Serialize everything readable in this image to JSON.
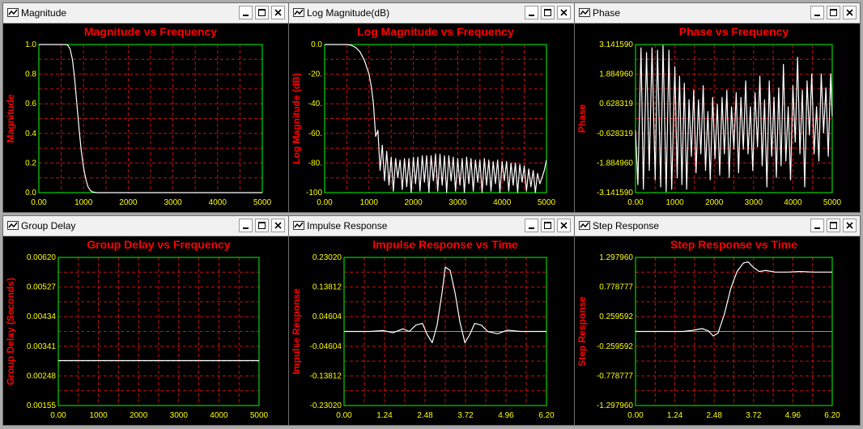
{
  "theme": {
    "titleColor": "#ff0000",
    "tickColor": "#ffff00",
    "gridColor": "#c81010",
    "frameColor": "#00ff00",
    "traceColor": "#ffffff",
    "zeroColor": "#00ff00"
  },
  "windows": [
    {
      "title": "Magnitude",
      "chart_data": {
        "type": "line",
        "title": "Magnitude vs Frequency",
        "xlabel": "",
        "ylabel": "Magnitude",
        "xlim": [
          0,
          5000
        ],
        "ylim": [
          0,
          1.0
        ],
        "xticks": [
          "0.00",
          "1000",
          "2000",
          "3000",
          "4000",
          "5000"
        ],
        "yticks": [
          "1.0",
          "0.8",
          "0.6",
          "0.4",
          "0.2",
          "0.0"
        ],
        "x": [
          0,
          500,
          600,
          650,
          700,
          750,
          800,
          850,
          900,
          950,
          1000,
          1050,
          1100,
          1150,
          1200,
          1300,
          1500,
          2000,
          3000,
          4000,
          5000
        ],
        "y": [
          1,
          1,
          1,
          0.995,
          0.97,
          0.9,
          0.77,
          0.6,
          0.43,
          0.28,
          0.17,
          0.09,
          0.04,
          0.015,
          0.005,
          0,
          0,
          0,
          0,
          0,
          0
        ],
        "gridX": 10,
        "gridY": 10
      }
    },
    {
      "title": "Log Magnitude(dB)",
      "chart_data": {
        "type": "line",
        "title": "Log Magnitude vs Frequency",
        "xlabel": "",
        "ylabel": "Log Magnitude (dB)",
        "xlim": [
          0,
          5000
        ],
        "ylim": [
          -100,
          0
        ],
        "xticks": [
          "0.00",
          "1000",
          "2000",
          "3000",
          "4000",
          "5000"
        ],
        "yticks": [
          "0.0",
          "-20.",
          "-40.",
          "-60.",
          "-80.",
          "-100"
        ],
        "x": [
          0,
          500,
          600,
          700,
          800,
          900,
          1000,
          1050,
          1100,
          1150,
          1200,
          1250,
          1300,
          1350,
          1400,
          1450,
          1500,
          1550,
          1600,
          1650,
          1700,
          1750,
          1800,
          1850,
          1900,
          1950,
          2000,
          2050,
          2100,
          2150,
          2200,
          2250,
          2300,
          2350,
          2400,
          2450,
          2500,
          2550,
          2600,
          2650,
          2700,
          2750,
          2800,
          2850,
          2900,
          2950,
          3000,
          3050,
          3100,
          3150,
          3200,
          3250,
          3300,
          3350,
          3400,
          3450,
          3500,
          3550,
          3600,
          3650,
          3700,
          3750,
          3800,
          3850,
          3900,
          3950,
          4000,
          4050,
          4100,
          4150,
          4200,
          4250,
          4300,
          4350,
          4400,
          4450,
          4500,
          4550,
          4600,
          4650,
          4700,
          4750,
          4800,
          4850,
          4900,
          4950,
          5000
        ],
        "y": [
          0,
          0,
          -0.5,
          -2,
          -5,
          -11,
          -20,
          -28,
          -40,
          -62,
          -58,
          -85,
          -68,
          -92,
          -72,
          -95,
          -76,
          -99,
          -77,
          -90,
          -78,
          -98,
          -77,
          -96,
          -77,
          -100,
          -76,
          -94,
          -76,
          -99,
          -75,
          -93,
          -75,
          -100,
          -75,
          -92,
          -74,
          -99,
          -74,
          -95,
          -75,
          -100,
          -75,
          -92,
          -76,
          -99,
          -77,
          -95,
          -77,
          -100,
          -76,
          -94,
          -77,
          -99,
          -78,
          -93,
          -78,
          -100,
          -77,
          -95,
          -78,
          -99,
          -79,
          -94,
          -78,
          -100,
          -79,
          -92,
          -79,
          -99,
          -80,
          -95,
          -80,
          -100,
          -81,
          -93,
          -82,
          -99,
          -84,
          -96,
          -85,
          -100,
          -87,
          -94,
          -90,
          -85,
          -78
        ],
        "gridX": 10,
        "gridY": 10
      }
    },
    {
      "title": "Phase",
      "chart_data": {
        "type": "line",
        "title": "Phase vs Frequency",
        "xlabel": "",
        "ylabel": "Phase",
        "xlim": [
          0,
          5000
        ],
        "ylim": [
          -3.14159,
          3.14159
        ],
        "xticks": [
          "0.00",
          "1000",
          "2000",
          "3000",
          "4000",
          "5000"
        ],
        "yticks": [
          "3.141590",
          "1.884960",
          "0.628319",
          "-0.628319",
          "-1.884960",
          "-3.141590"
        ],
        "x": [
          0,
          60,
          140,
          200,
          280,
          350,
          420,
          500,
          560,
          640,
          700,
          780,
          850,
          920,
          1000,
          1060,
          1120,
          1180,
          1240,
          1300,
          1360,
          1420,
          1480,
          1540,
          1600,
          1660,
          1720,
          1780,
          1840,
          1900,
          1960,
          2020,
          2080,
          2140,
          2200,
          2260,
          2320,
          2380,
          2440,
          2500,
          2560,
          2620,
          2680,
          2740,
          2800,
          2860,
          2920,
          2980,
          3040,
          3100,
          3160,
          3220,
          3280,
          3340,
          3400,
          3460,
          3520,
          3580,
          3640,
          3700,
          3760,
          3820,
          3880,
          3940,
          4000,
          4060,
          4120,
          4180,
          4240,
          4300,
          4360,
          4420,
          4480,
          4540,
          4600,
          4660,
          4720,
          4780,
          4840,
          4900,
          4960,
          5000
        ],
        "y": [
          -0.5,
          -2.8,
          3.0,
          -3.0,
          2.8,
          -2.2,
          3.0,
          -2.6,
          2.9,
          -2.9,
          3.1,
          -3.1,
          2.9,
          -3.0,
          2.2,
          -2.5,
          1.8,
          -2.8,
          1.5,
          -3.0,
          0.8,
          -1.6,
          1.2,
          -2.3,
          0.8,
          -1.5,
          1.4,
          -2.2,
          0.3,
          -2.6,
          0.9,
          -1.7,
          0.6,
          -2.4,
          0.9,
          -1.5,
          1.2,
          -2.5,
          0.5,
          -1.3,
          1.1,
          -2.3,
          0.9,
          -1.3,
          1.6,
          -1.5,
          0.5,
          -2.2,
          1.1,
          -1.2,
          1.8,
          -2.0,
          0.8,
          -2.9,
          1.6,
          -1.6,
          0.9,
          -2.5,
          1.3,
          -2.0,
          2.3,
          -1.8,
          0.5,
          -2.6,
          1.4,
          -1.0,
          2.6,
          -1.5,
          1.2,
          -2.9,
          1.6,
          -0.7,
          1.9,
          -1.5,
          0.5,
          -1.8,
          1.9,
          -0.6,
          1.3,
          -1.6,
          1.9,
          0.1
        ],
        "gridX": 10,
        "gridY": 10
      }
    },
    {
      "title": "Group Delay",
      "chart_data": {
        "type": "line",
        "title": "Group Delay vs Frequency",
        "xlabel": "",
        "ylabel": "Group Delay (Seconds)",
        "xlim": [
          0,
          5000
        ],
        "ylim": [
          0.00155,
          0.0062
        ],
        "xticks": [
          "0.00",
          "1000",
          "2000",
          "3000",
          "4000",
          "5000"
        ],
        "yticks": [
          "0.00620",
          "0.00527",
          "0.00434",
          "0.00341",
          "0.00248",
          "0.00155"
        ],
        "x": [
          0,
          5000
        ],
        "y": [
          0.00296,
          0.00296
        ],
        "gridX": 10,
        "gridY": 10
      }
    },
    {
      "title": "Impulse Response",
      "chart_data": {
        "type": "line",
        "title": "Impulse Response vs Time",
        "xlabel": "",
        "ylabel": "Impulse Response",
        "xlim": [
          0,
          6.2
        ],
        "ylim": [
          -0.2302,
          0.2302
        ],
        "zeroLine": true,
        "xticks": [
          "0.00",
          "1.24",
          "2.48",
          "3.72",
          "4.96",
          "6.20"
        ],
        "yticks": [
          "0.23020",
          "0.13812",
          "0.04604",
          "-0.04604",
          "-0.13812",
          "-0.23020"
        ],
        "x": [
          0,
          0.8,
          1.2,
          1.5,
          1.8,
          2.0,
          2.2,
          2.4,
          2.55,
          2.7,
          2.85,
          3.0,
          3.1,
          3.25,
          3.4,
          3.55,
          3.7,
          3.85,
          4.0,
          4.2,
          4.4,
          4.7,
          5.0,
          5.4,
          6.2
        ],
        "y": [
          0,
          0,
          0.003,
          -0.004,
          0.008,
          0,
          0.02,
          0.025,
          -0.01,
          -0.035,
          0.02,
          0.12,
          0.2,
          0.19,
          0.12,
          0.03,
          -0.035,
          -0.01,
          0.025,
          0.02,
          0,
          -0.007,
          0.004,
          0,
          0
        ],
        "gridX": 10,
        "gridY": 10
      }
    },
    {
      "title": "Step Response",
      "chart_data": {
        "type": "line",
        "title": "Step Response vs Time",
        "xlabel": "",
        "ylabel": "Step Response",
        "xlim": [
          0,
          6.2
        ],
        "ylim": [
          -1.29796,
          1.29796
        ],
        "zeroLine": true,
        "xticks": [
          "0.00",
          "1.24",
          "2.48",
          "3.72",
          "4.96",
          "6.20"
        ],
        "yticks": [
          "1.297960",
          "0.778777",
          "0.259592",
          "-0.259592",
          "-0.778777",
          "-1.297960"
        ],
        "x": [
          0,
          1.5,
          1.8,
          2.1,
          2.3,
          2.45,
          2.6,
          2.8,
          3.0,
          3.2,
          3.4,
          3.55,
          3.7,
          3.9,
          4.1,
          4.4,
          4.8,
          5.2,
          5.6,
          6.2
        ],
        "y": [
          0,
          0,
          0.02,
          0.05,
          0.01,
          -0.08,
          -0.03,
          0.3,
          0.75,
          1.05,
          1.2,
          1.22,
          1.13,
          1.05,
          1.07,
          1.04,
          1.04,
          1.05,
          1.04,
          1.04
        ],
        "gridX": 10,
        "gridY": 10
      }
    }
  ]
}
